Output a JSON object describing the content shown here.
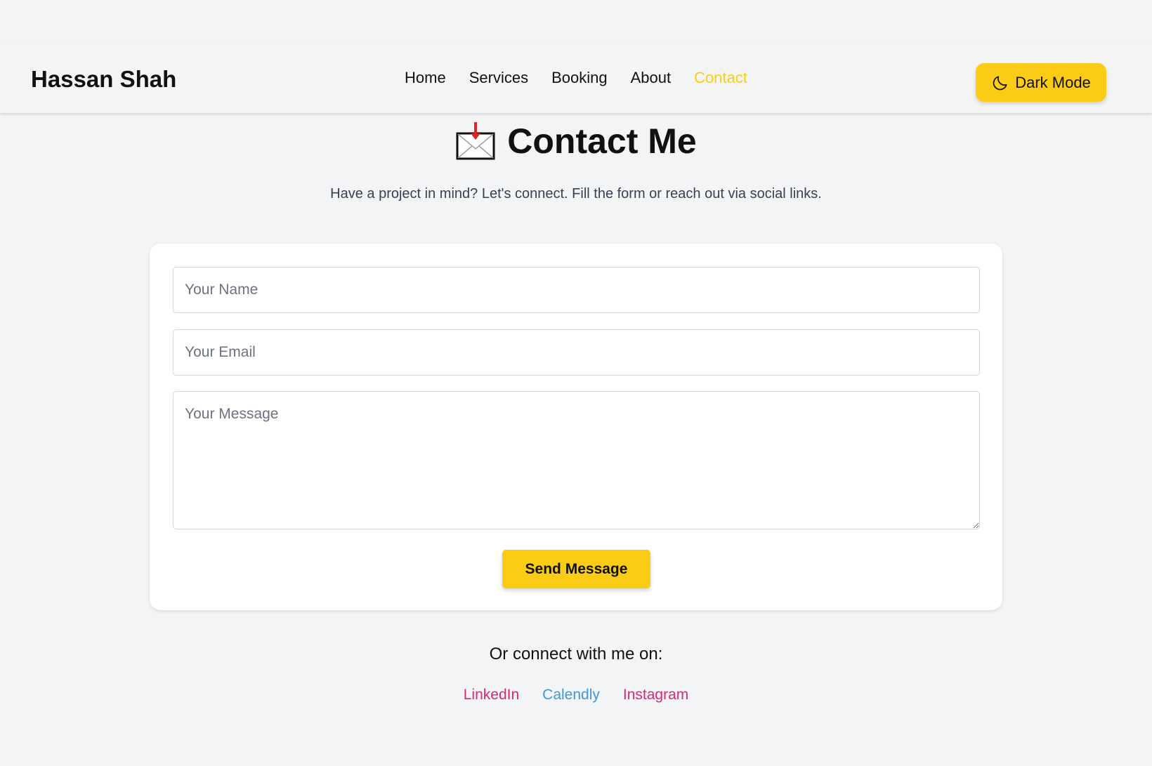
{
  "nav": {
    "brand": "Hassan Shah",
    "links": [
      {
        "label": "Home"
      },
      {
        "label": "Services"
      },
      {
        "label": "Booking"
      },
      {
        "label": "About"
      },
      {
        "label": "Contact",
        "active": true
      }
    ],
    "dark_mode_label": "Dark Mode",
    "dark_mode_icon": "moon-icon"
  },
  "header": {
    "title": "Contact Me",
    "title_icon": "incoming-envelope-icon",
    "subtitle": "Have a project in mind? Let's connect. Fill the form or reach out via social links."
  },
  "form": {
    "name_placeholder": "Your Name",
    "name_value": "",
    "email_placeholder": "Your Email",
    "email_value": "",
    "message_placeholder": "Your Message",
    "message_value": "",
    "submit_label": "Send Message"
  },
  "social": {
    "heading": "Or connect with me on:",
    "links": [
      {
        "label": "LinkedIn",
        "color": "#db2777"
      },
      {
        "label": "Calendly",
        "color": "#3b9ad9"
      },
      {
        "label": "Instagram",
        "color": "#db2777"
      }
    ]
  },
  "colors": {
    "accent": "#facc15",
    "background": "#f3f4f6",
    "card": "#ffffff"
  }
}
